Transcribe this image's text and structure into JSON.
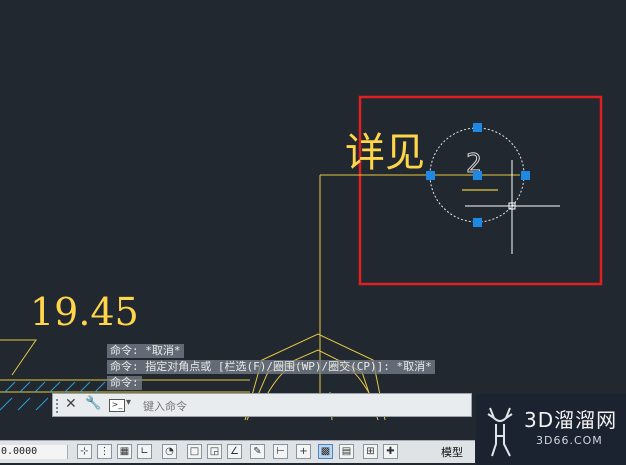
{
  "drawing": {
    "label_detail": "详见",
    "dimension": "19.45",
    "bubble_number": "2"
  },
  "command_history": [
    "命令: *取消*",
    "命令: 指定对角点或 [栏选(F)/圈围(WP)/圈交(CP)]: *取消*",
    "命令:"
  ],
  "command_line": {
    "placeholder": "键入命令",
    "close_glyph": "✕",
    "settings_glyph": "🔧",
    "prompt_glyph": ">_",
    "dropdown_glyph": "▾"
  },
  "status_bar": {
    "coords": "0.0000",
    "model_label": "模型"
  },
  "watermark": {
    "brand": "3D溜溜网",
    "site": "3D66.COM"
  },
  "colors": {
    "background": "#212830",
    "line_yellow": "#ffd54a",
    "selection_red": "#e02020",
    "grip_blue": "#1e88e5"
  }
}
